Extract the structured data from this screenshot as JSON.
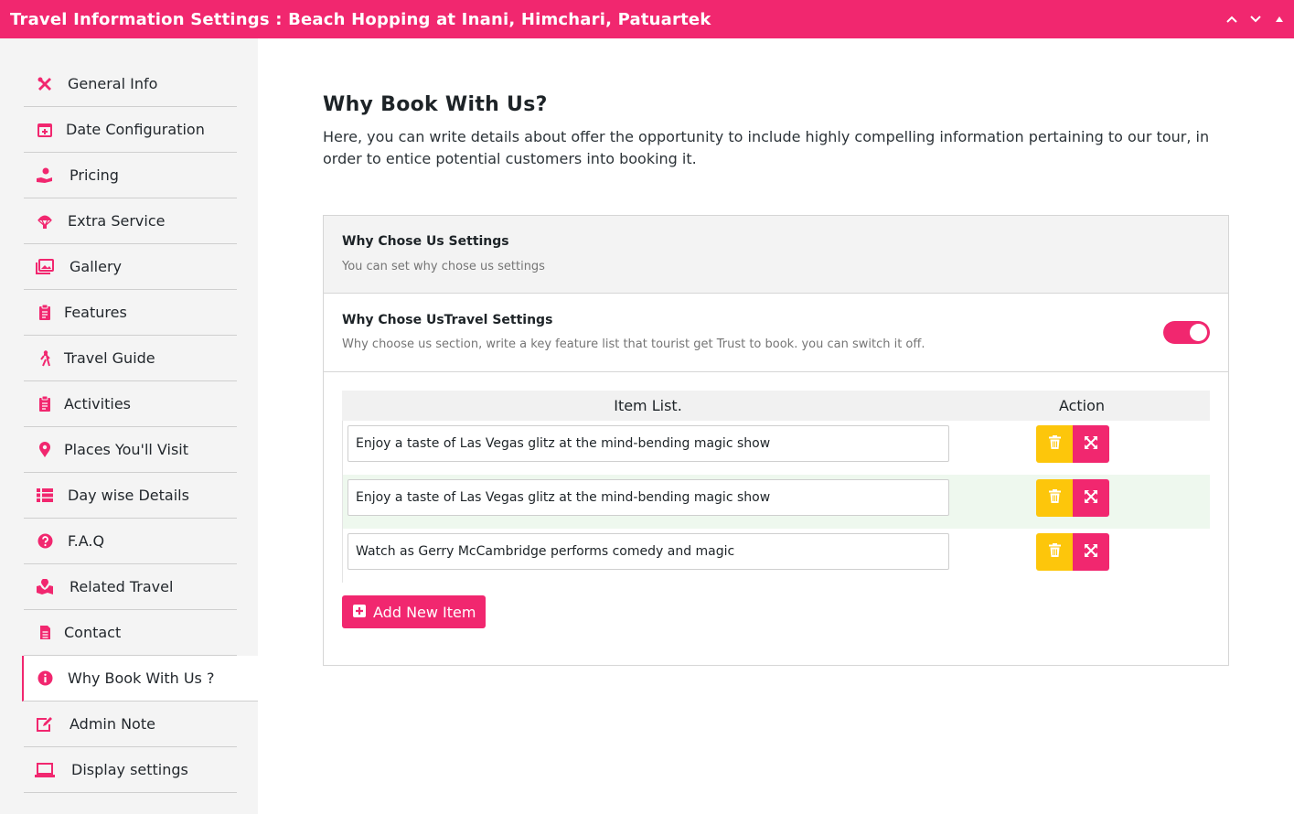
{
  "window": {
    "title": "Travel Information Settings : Beach Hopping at Inani, Himchari, Patuartek",
    "controls": [
      "chevron-up-icon",
      "chevron-down-icon",
      "caret-up-icon"
    ]
  },
  "sidebar": {
    "items": [
      {
        "label": "General Info",
        "icon": "tools-icon"
      },
      {
        "label": "Date Configuration",
        "icon": "calendar-plus-icon"
      },
      {
        "label": "Pricing",
        "icon": "hand-dollar-icon"
      },
      {
        "label": "Extra Service",
        "icon": "parachute-icon"
      },
      {
        "label": "Gallery",
        "icon": "images-icon"
      },
      {
        "label": "Features",
        "icon": "clipboard-icon"
      },
      {
        "label": "Travel Guide",
        "icon": "hiking-icon"
      },
      {
        "label": "Activities",
        "icon": "clipboard-list-icon"
      },
      {
        "label": "Places You'll Visit",
        "icon": "map-marker-icon"
      },
      {
        "label": "Day wise Details",
        "icon": "list-icon"
      },
      {
        "label": "F.A.Q",
        "icon": "question-circle-icon"
      },
      {
        "label": "Related Travel",
        "icon": "map-marked-icon"
      },
      {
        "label": "Contact",
        "icon": "file-alt-icon"
      },
      {
        "label": "Why Book With Us ?",
        "icon": "info-circle-icon",
        "active": true
      },
      {
        "label": "Admin Note",
        "icon": "edit-icon"
      },
      {
        "label": "Display settings",
        "icon": "laptop-icon"
      }
    ]
  },
  "main": {
    "heading": "Why Book With Us?",
    "description": "Here, you can write details about offer the opportunity to include highly compelling information pertaining to our tour, in order to entice potential customers into booking it.",
    "panel": {
      "title": "Why Chose Us Settings",
      "subtitle": "You can set why chose us settings",
      "setting": {
        "title": "Why Chose UsTravel Settings",
        "description": "Why choose us section, write a key feature list that tourist get Trust to book. you can switch it off.",
        "enabled": true
      },
      "table": {
        "col_items": "Item List.",
        "col_action": "Action",
        "rows": [
          {
            "value": "Enjoy a taste of Las Vegas glitz at the mind-bending magic show"
          },
          {
            "value": "Enjoy a taste of Las Vegas glitz at the mind-bending magic show"
          },
          {
            "value": "Watch as Gerry McCambridge performs comedy and magic"
          }
        ]
      },
      "add_button": "Add New Item"
    }
  },
  "colors": {
    "accent": "#f1276f",
    "delete": "#fdc60b",
    "row_highlight": "#eef8ee"
  }
}
